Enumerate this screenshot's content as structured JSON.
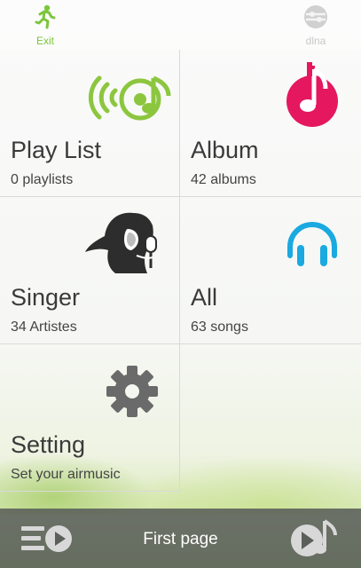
{
  "topbar": {
    "exit_label": "Exit",
    "dlna_label": "dlna"
  },
  "tiles": [
    {
      "title": "Play List",
      "subtitle": "0 playlists",
      "icon": "playlist-broadcast-icon"
    },
    {
      "title": "Album",
      "subtitle": "42 albums",
      "icon": "music-note-icon"
    },
    {
      "title": "Singer",
      "subtitle": "34 Artistes",
      "icon": "singer-silhouette-icon"
    },
    {
      "title": "All",
      "subtitle": "63 songs",
      "icon": "headphones-icon"
    },
    {
      "title": "Setting",
      "subtitle": "Set your airmusic",
      "icon": "gear-icon"
    }
  ],
  "bottombar": {
    "title": "First page",
    "left_icon": "queue-play-icon",
    "right_icon": "now-playing-icon"
  },
  "colors": {
    "exit_green": "#7cc63a",
    "playlist_green": "#8cc63f",
    "album_pink": "#e5175f",
    "headphones_blue": "#1aa9e0",
    "gear_gray": "#6a6a6a",
    "bottombar": "#5a5f5a"
  }
}
